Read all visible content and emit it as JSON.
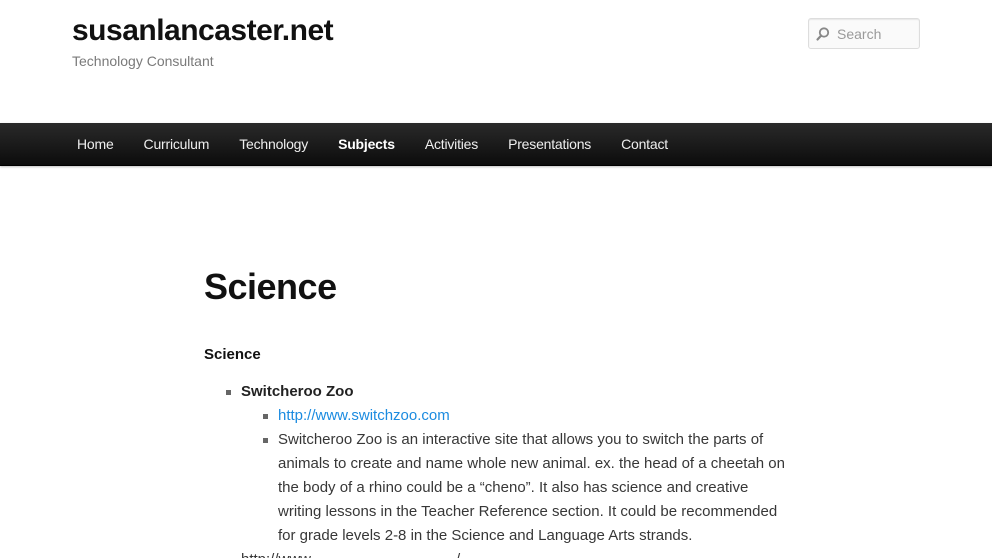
{
  "site": {
    "title": "susanlancaster.net",
    "description": "Technology Consultant"
  },
  "search": {
    "placeholder": "Search",
    "icon": "search-icon"
  },
  "nav": {
    "items": [
      {
        "label": "Home"
      },
      {
        "label": "Curriculum"
      },
      {
        "label": "Technology"
      },
      {
        "label": "Subjects"
      },
      {
        "label": "Activities"
      },
      {
        "label": "Presentations"
      },
      {
        "label": "Contact"
      }
    ],
    "active": "Subjects"
  },
  "main": {
    "title": "Science",
    "section_heading": "Science",
    "items": [
      {
        "title": "Switcheroo Zoo",
        "link": "http://www.switchzoo.com",
        "description": "Switcheroo Zoo is an interactive site that allows you to switch the parts of animals to create and name whole new animal. ex. the head of a cheetah on the body of a rhino could be a “cheno”. It also has science and creative writing lessons in the Teacher Reference section. It could be recommended for grade levels 2-8 in the Science and Language Arts strands."
      }
    ],
    "cutoff_text": "http://www.................................../"
  },
  "colors": {
    "nav_bg": "#111111",
    "link": "#1b8be0",
    "title": "#111111"
  }
}
